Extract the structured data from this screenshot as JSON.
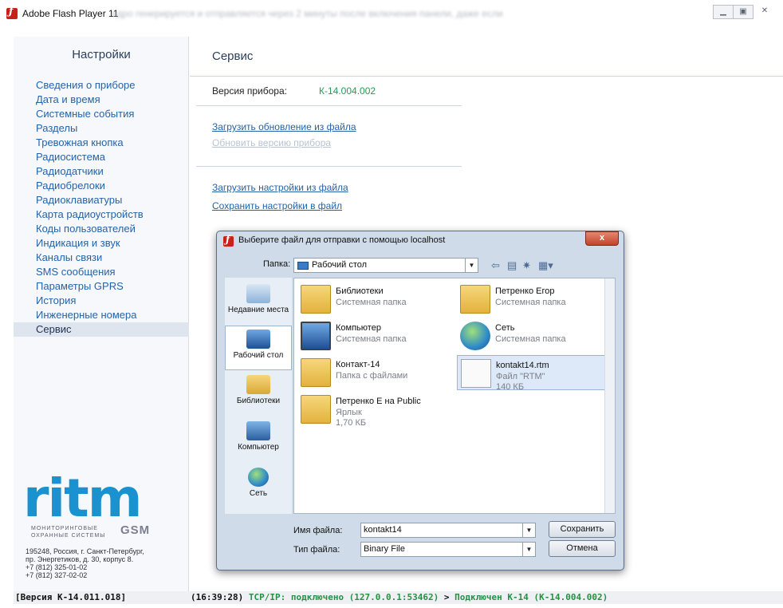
{
  "window": {
    "title": "Adobe Flash Player 11",
    "background_text": "…ядро генерируется и отправляется через 2 минуты после включения панели, даже если"
  },
  "sidebar": {
    "header": "Настройки",
    "items": [
      {
        "label": "Сведения о приборе"
      },
      {
        "label": "Дата и время"
      },
      {
        "label": "Системные события"
      },
      {
        "label": "Разделы"
      },
      {
        "label": "Тревожная кнопка"
      },
      {
        "label": "Радиосистема"
      },
      {
        "label": "Радиодатчики"
      },
      {
        "label": "Радиобрелоки"
      },
      {
        "label": "Радиоклавиатуры"
      },
      {
        "label": "Карта радиоустройств"
      },
      {
        "label": "Коды пользователей"
      },
      {
        "label": "Индикация и звук"
      },
      {
        "label": "Каналы связи"
      },
      {
        "label": "SMS сообщения"
      },
      {
        "label": "Параметры GPRS"
      },
      {
        "label": "История"
      },
      {
        "label": "Инженерные номера"
      },
      {
        "label": "Сервис"
      }
    ],
    "active_item": "Сервис",
    "logo": {
      "word": "ritm",
      "tagline_line1": "МОНИТОРИНГОВЫЕ",
      "tagline_line2": "ОХРАННЫЕ СИСТЕМЫ",
      "gsm": "GSM"
    },
    "address": [
      "195248, Россия, г. Санкт-Петербург,",
      "пр. Энергетиков, д. 30, корпус 8.",
      "+7 (812) 325-01-02",
      "+7 (812) 327-02-02"
    ]
  },
  "main": {
    "title": "Сервис",
    "version_label": "Версия прибора:",
    "version_value": "К-14.004.002",
    "links": {
      "upload_update": "Загрузить обновление из файла",
      "update_firmware": "Обновить версию прибора",
      "load_settings": "Загрузить настройки из файла",
      "save_settings": "Сохранить настройки в файл"
    }
  },
  "status_bar": {
    "version": "[Версия К-14.011.018]",
    "time": "(16:39:28)",
    "connection": "TCP/IP: подключено (127.0.0.1:53462)",
    "arrow": ">",
    "device": "Подключен К-14 (К-14.004.002)"
  },
  "dialog": {
    "title": "Выберите файл для отправки с помощью localhost",
    "close_label": "x",
    "folder_label": "Папка:",
    "folder_value": "Рабочий стол",
    "places": [
      {
        "label": "Недавние места",
        "icon": "recent-places-icon"
      },
      {
        "label": "Рабочий стол",
        "icon": "desktop-icon"
      },
      {
        "label": "Библиотеки",
        "icon": "libraries-icon"
      },
      {
        "label": "Компьютер",
        "icon": "computer-icon"
      },
      {
        "label": "Сеть",
        "icon": "network-icon"
      }
    ],
    "files": [
      {
        "name": "Библиотеки",
        "desc": "Системная папка",
        "size": ""
      },
      {
        "name": "Петренко Егор",
        "desc": "Системная папка",
        "size": ""
      },
      {
        "name": "Компьютер",
        "desc": "Системная папка",
        "size": ""
      },
      {
        "name": "Сеть",
        "desc": "Системная папка",
        "size": ""
      },
      {
        "name": "Контакт-14",
        "desc": "Папка с файлами",
        "size": ""
      },
      {
        "name": "kontakt14.rtm",
        "desc": "Файл \"RTM\"",
        "size": "140 КБ"
      },
      {
        "name": "Петренко Е на Public",
        "desc": "Ярлык",
        "size": "1,70 КБ"
      }
    ],
    "filename_label": "Имя файла:",
    "filename_value": "kontakt14",
    "filetype_label": "Тип файла:",
    "filetype_value": "Binary File",
    "save_button": "Сохранить",
    "cancel_button": "Отмена"
  },
  "colors": {
    "link": "#2563a8",
    "version_value": "#279a52",
    "status_green": "#249143",
    "logo": "#1a92cf"
  }
}
